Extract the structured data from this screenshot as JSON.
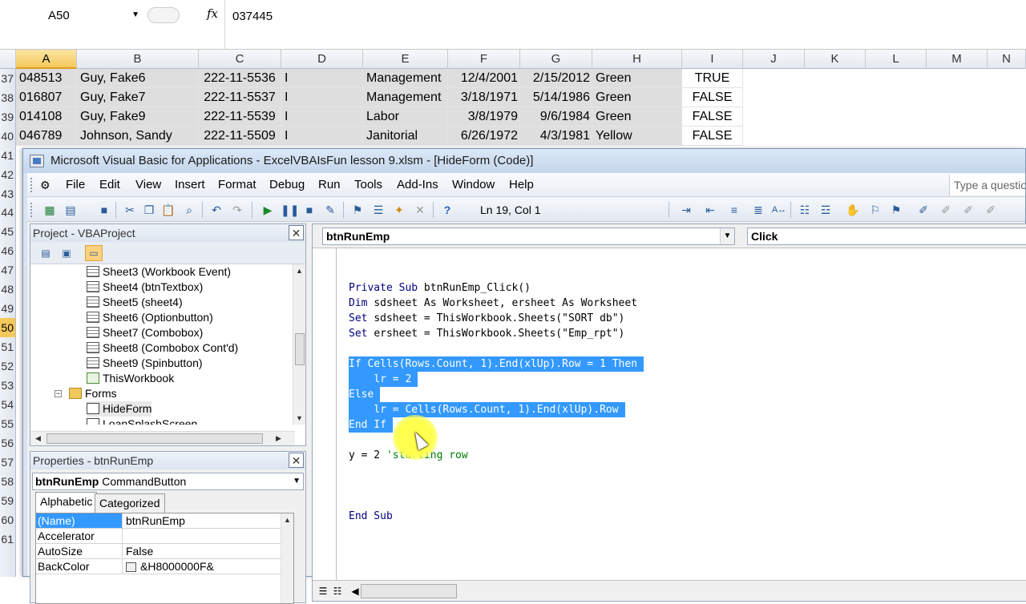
{
  "excel": {
    "name_box": "A50",
    "fx_symbol": "fx",
    "formula_value": "037445",
    "columns": [
      "A",
      "B",
      "C",
      "D",
      "E",
      "F",
      "G",
      "H",
      "I",
      "J",
      "K",
      "L",
      "M",
      "N"
    ],
    "row_headers": [
      "37",
      "38",
      "39",
      "40",
      "41",
      "42",
      "43",
      "44",
      "45",
      "46",
      "47",
      "48",
      "49",
      "50",
      "51",
      "52",
      "53",
      "54",
      "55",
      "56",
      "57",
      "58",
      "59",
      "60",
      "61"
    ],
    "rows": [
      {
        "a": "048513",
        "b": "Guy, Fake6",
        "c": "222-11-5536",
        "d": "I",
        "e": "Management",
        "f": "12/4/2001",
        "g": "2/15/2012",
        "h": "Green",
        "i": "TRUE"
      },
      {
        "a": "016807",
        "b": "Guy, Fake7",
        "c": "222-11-5537",
        "d": "I",
        "e": "Management",
        "f": "3/18/1971",
        "g": "5/14/1986",
        "h": "Green",
        "i": "FALSE"
      },
      {
        "a": "014108",
        "b": "Guy, Fake9",
        "c": "222-11-5539",
        "d": "I",
        "e": "Labor",
        "f": "3/8/1979",
        "g": "9/6/1984",
        "h": "Green",
        "i": "FALSE"
      },
      {
        "a": "046789",
        "b": "Johnson, Sandy",
        "c": "222-11-5509",
        "d": "I",
        "e": "Janitorial",
        "f": "6/26/1972",
        "g": "4/3/1981",
        "h": "Yellow",
        "i": "FALSE"
      }
    ]
  },
  "vba": {
    "title": "Microsoft Visual Basic for Applications - ExcelVBAIsFun lesson 9.xlsm - [HideForm (Code)]",
    "menu": [
      "File",
      "Edit",
      "View",
      "Insert",
      "Format",
      "Debug",
      "Run",
      "Tools",
      "Add-Ins",
      "Window",
      "Help"
    ],
    "help_placeholder": "Type a question",
    "cursor_position": "Ln 19, Col 1",
    "project": {
      "title": "Project - VBAProject",
      "tree": [
        {
          "label": "Sheet3 (Workbook Event)",
          "type": "sheet"
        },
        {
          "label": "Sheet4 (btnTextbox)",
          "type": "sheet"
        },
        {
          "label": "Sheet5 (sheet4)",
          "type": "sheet"
        },
        {
          "label": "Sheet6 (Optionbutton)",
          "type": "sheet"
        },
        {
          "label": "Sheet7 (Combobox)",
          "type": "sheet"
        },
        {
          "label": "Sheet8 (Combobox Cont'd)",
          "type": "sheet"
        },
        {
          "label": "Sheet9 (Spinbutton)",
          "type": "sheet"
        },
        {
          "label": "ThisWorkbook",
          "type": "workbook"
        },
        {
          "label": "Forms",
          "type": "folder"
        },
        {
          "label": "HideForm",
          "type": "form"
        },
        {
          "label": "LoanSplashScreen",
          "type": "form"
        }
      ]
    },
    "properties": {
      "title": "Properties - btnRunEmp",
      "object_name": "btnRunEmp",
      "object_type": "CommandButton",
      "tabs": [
        "Alphabetic",
        "Categorized"
      ],
      "rows": [
        {
          "key": "(Name)",
          "value": "btnRunEmp"
        },
        {
          "key": "Accelerator",
          "value": ""
        },
        {
          "key": "AutoSize",
          "value": "False"
        },
        {
          "key": "BackColor",
          "value": "&H8000000F&"
        }
      ]
    },
    "code": {
      "object_combo": "btnRunEmp",
      "proc_combo": "Click",
      "lines": [
        {
          "kw": "Private Sub ",
          "rest": "btnRunEmp_Click()",
          "hl": false
        },
        {
          "kw": "Dim ",
          "rest": "sdsheet As Worksheet, ersheet As Worksheet",
          "hl": false
        },
        {
          "kw": "Set ",
          "rest": "sdsheet = ThisWorkbook.Sheets(\"SORT db\")",
          "hl": false
        },
        {
          "kw": "Set ",
          "rest": "ersheet = ThisWorkbook.Sheets(\"Emp_rpt\")",
          "hl": false
        },
        {
          "kw": "If ",
          "rest": "Cells(Rows.Count, 1).End(xlUp).Row = 1 Then",
          "hl": true
        },
        {
          "kw": "    ",
          "rest": "lr = 2",
          "hl": true
        },
        {
          "kw": "Else",
          "rest": "",
          "hl": true
        },
        {
          "kw": "    ",
          "rest": "lr = Cells(Rows.Count, 1).End(xlUp).Row",
          "hl": true
        },
        {
          "kw": "End If",
          "rest": "",
          "hl": true
        },
        {
          "kw": "",
          "rest": "y = 2 ",
          "comment": "'starting row",
          "hl": false
        },
        {
          "kw": "End Sub",
          "rest": "",
          "hl": false
        }
      ]
    }
  }
}
